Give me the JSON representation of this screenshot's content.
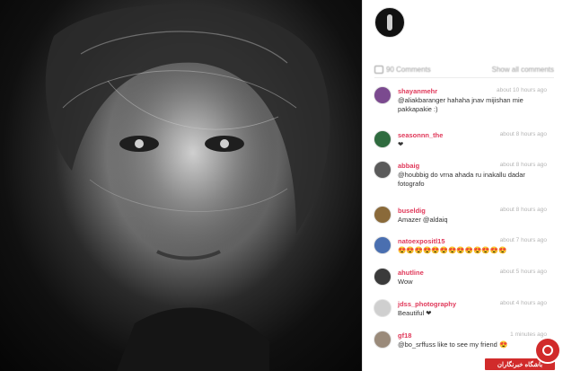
{
  "post": {
    "image_description": "",
    "comments_count_label": "90 Comments",
    "show_all_label": "Show all comments"
  },
  "comments": [
    {
      "user": "shayanmehr",
      "time": "about 10 hours ago",
      "text": "@aliakbaranger hahaha jnav mijishan mie pakkapakie :)",
      "mention": ""
    },
    {
      "user": "seasonnn_the",
      "time": "about 8 hours ago",
      "text": "❤",
      "mention": ""
    },
    {
      "user": "abbaig",
      "time": "about 8 hours ago",
      "text": "@houbbig do vrna ahada ru inakallu dadar fotografo",
      "mention": ""
    },
    {
      "user": "buseldig",
      "time": "about 8 hours ago",
      "text": "Amazer @aldaiq",
      "mention": ""
    },
    {
      "user": "natoexpositl15",
      "time": "about 7 hours ago",
      "text": "😍😍😍😍😍😍😍😍😍😍😍😍😍",
      "mention": ""
    },
    {
      "user": "ahutline",
      "time": "about 5 hours ago",
      "text": "Wow",
      "mention": ""
    },
    {
      "user": "jdss_photography",
      "time": "about 4 hours ago",
      "text": "Beautiful ❤",
      "mention": ""
    },
    {
      "user": "gf18",
      "time": "1 minutes ago",
      "text": "@bo_srffuss like to see my friend 😍",
      "mention": ""
    }
  ],
  "badge": {
    "label": "باشگاه خبرنگاران"
  },
  "colors": {
    "username": "#e0395a",
    "mention": "#4a7ac9",
    "badge_red": "#d12b2b"
  }
}
